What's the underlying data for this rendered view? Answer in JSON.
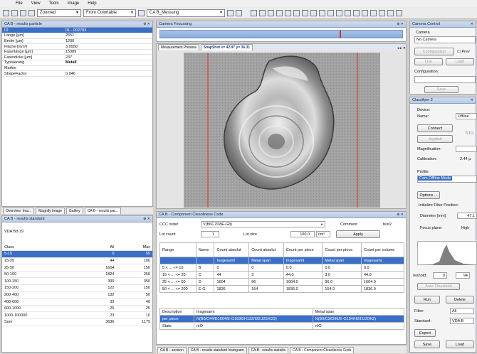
{
  "menu": [
    "File",
    "View",
    "Tools",
    "Image",
    "Help"
  ],
  "toolbar": {
    "zoom": "Zoomed",
    "colortable": "From Colortable",
    "measure": "CA B_Messung"
  },
  "results_particle": {
    "title": "CA B - results particle",
    "rows": [
      {
        "k": "ID",
        "v": "01 - 002783"
      },
      {
        "k": "Länge [µm]",
        "v": "2651"
      },
      {
        "k": "Breite [µm]",
        "v": "1200"
      },
      {
        "k": "Fläche [mm²]",
        "v": "3.0950"
      },
      {
        "k": "Faserlänge [µm]",
        "v": "15089"
      },
      {
        "k": "Faserdicke [µm]",
        "v": "237"
      },
      {
        "k": "Typisierung",
        "v": "Metall"
      },
      {
        "k": "Marker",
        "v": ""
      },
      {
        "k": "ShapeFactor",
        "v": "0.046"
      }
    ]
  },
  "left_tabs": [
    "Overview: Ima...",
    "Magnify Image",
    "Gallery",
    "CA B - results par..."
  ],
  "results_standard": {
    "title": "CA B - results standard",
    "label": "VDA Bd 19",
    "headers": [
      "Class",
      "All",
      "Max"
    ],
    "rows": [
      [
        "5-15",
        "0",
        "50"
      ],
      [
        "15-25",
        "44",
        "100"
      ],
      [
        "25-50",
        "1604",
        "150"
      ],
      [
        "50-100",
        "1824",
        "250"
      ],
      [
        "100-150",
        "390",
        "350"
      ],
      [
        "150-200",
        "122",
        "150"
      ],
      [
        "200-400",
        "132",
        "50"
      ],
      [
        "400-600",
        "32",
        "40"
      ],
      [
        "600-1000",
        "25",
        "25"
      ],
      [
        "1000-100000",
        "23",
        "10"
      ],
      [
        "Sum",
        "3636",
        "1175"
      ]
    ]
  },
  "camera_focusing": {
    "title": "Camera Focussing"
  },
  "image_tabs": {
    "measurement": "Measurement Preview",
    "snapshot": "SnapShot x= 42.97 y= 36.31"
  },
  "ccc": {
    "title": "CA B - Component Cleanliness Code",
    "ccc_order_label": "CCC order",
    "ccc_order_value": "V(B6C7D8E-G8)",
    "comment_label": "Comment",
    "comment_value": "test2",
    "lot_count_label": "Lot count",
    "lot_count_value": "1",
    "lot_size_label": "Lot size",
    "lot_size_value": "100.0",
    "lot_unit": "cm²",
    "apply": "Apply",
    "headers": [
      "Range",
      "Name",
      "Count absolut",
      "Count absolut",
      "Count per piece",
      "Count per piece",
      "Count per volume"
    ],
    "subrow": [
      "",
      "",
      "Insgesamt",
      "Metal span",
      "Insgesamt",
      "Metal span",
      "Insgesamt"
    ],
    "rows": [
      [
        "5 < ... <= 15",
        "B",
        "0",
        "0",
        "0.0",
        "0.0",
        "0.0"
      ],
      [
        "15 < ... <= 25",
        "C",
        "44",
        "3",
        "44.0",
        "3.0",
        "44.0"
      ],
      [
        "25 < ... <= 50",
        "D",
        "1604",
        "96",
        "1604.0",
        "96.0",
        "1604.0"
      ],
      [
        "50 < ... <= 200",
        "E-G",
        "1836",
        "154",
        "1836.0",
        "154.0",
        "1836.0"
      ]
    ],
    "desc_headers": [
      "Description",
      "Insgesamt",
      "Metal span"
    ],
    "desc_rows": [
      [
        "per piece",
        "N(B0/C44/D1604/E-G1836/H132/I32/J25/K23)",
        "N(B0/C3/D96/E-G154/H2/I2/J2/K2)"
      ],
      [
        "State",
        "nIO",
        "nIO"
      ]
    ]
  },
  "bottom_tabs": [
    "CA B - session",
    "CA B - results standard histogram",
    "CA B - results statistic",
    "CA B - Component Cleanliness Code"
  ],
  "camera_control": {
    "title": "Camera Control",
    "camera_label": "Camera",
    "camera_value": "No Camera",
    "configuration_btn": "Configuration",
    "preview_check": "Prev",
    "live_btn": "Live",
    "load_btn": "Load",
    "configuration_label": "Configuration:",
    "save_btn": "Save"
  },
  "classifyer": {
    "title": "Classifyer 3",
    "device_label": "Device:",
    "name_label": "Name:",
    "name_value": "Offline",
    "connect_btn": "Connect",
    "joystick_btn": "Joystick",
    "sto_value": "STO",
    "magnification_label": "Magnification:",
    "calibration_label": "Calibration:",
    "calibration_value": "2.44 µ",
    "profile_label": "Profile:",
    "profile_value": "Cam Offline Mode",
    "options_btn": "Options ...",
    "filter_position_label": "Initialize Filter Position:",
    "diameter_label": "Diameter [mm]:",
    "diameter_value": "47.1",
    "focus_label": "Focus plane:",
    "focus_value": "High",
    "threshold_label": "reshold:",
    "threshold_min": "0",
    "threshold_max": "94",
    "auto_threshold": "Auto Threshold",
    "run_btn": "Run",
    "delete_btn": "Delete",
    "filter_label": "Filter:",
    "filter_value": "All",
    "standard_label": "Standard:",
    "standard_value": "VDA B",
    "export_btn": "Export",
    "save_btn": "Save",
    "load_btn": "Load"
  },
  "colors": {
    "accent": "#3a6fc8",
    "titlebar": "#b9cbe4",
    "redline": "#d63030"
  }
}
